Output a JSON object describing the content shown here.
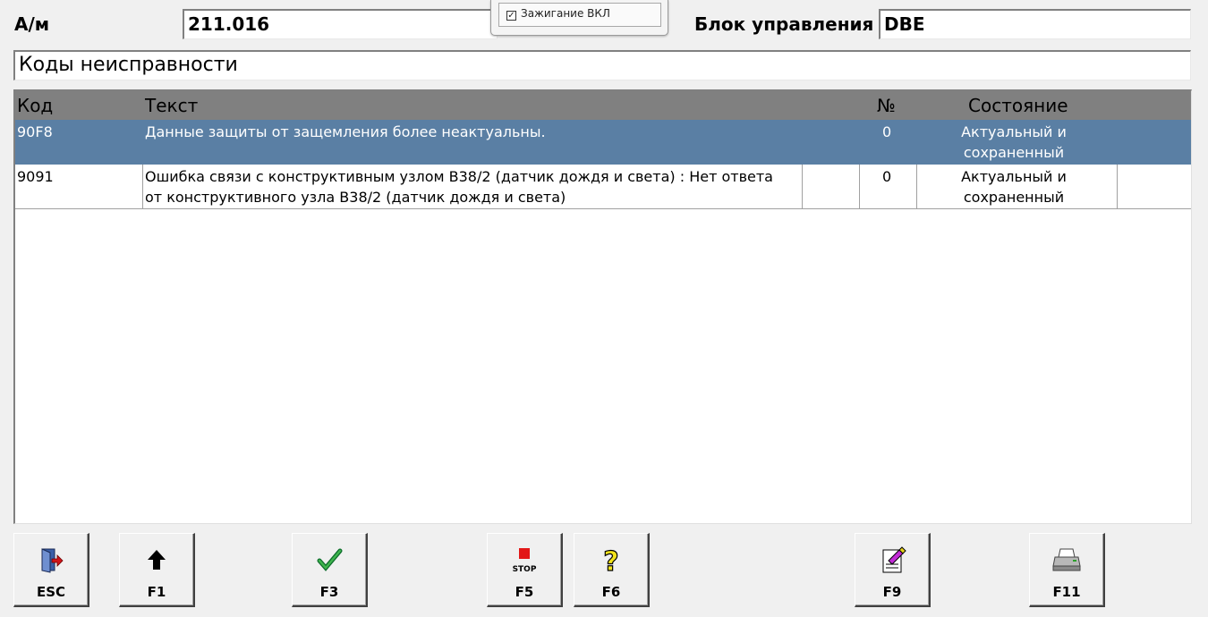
{
  "header": {
    "car_label": "А/м",
    "car_value": "211.016",
    "ecu_label": "Блок управления",
    "ecu_value": "DBE"
  },
  "ignition": {
    "label": "Зажигание ВКЛ",
    "checked": true
  },
  "section_title": "Коды неисправности",
  "table": {
    "columns": [
      "Код",
      "Текст",
      "№",
      "Состояние"
    ],
    "rows": [
      {
        "code": "90F8",
        "text": "Данные защиты от защемления более неактуальны.",
        "text2": "",
        "num": "0",
        "state1": "Актуальный и",
        "state2": "сохраненный",
        "selected": true
      },
      {
        "code": "9091",
        "text": "Ошибка связи с конструктивным узлом B38/2 (датчик дождя и света) : Нет ответа",
        "text2": "от конструктивного узла B38/2 (датчик дождя и света)",
        "num": "0",
        "state1": "Актуальный и",
        "state2": "сохраненный",
        "selected": false
      }
    ]
  },
  "buttons": [
    {
      "key": "ESC",
      "icon": "exit-door-icon"
    },
    {
      "key": "F1",
      "icon": "arrow-up-icon"
    },
    {
      "key": "F3",
      "icon": "checkmark-icon"
    },
    {
      "key": "F5",
      "icon": "stop-icon",
      "icon_text": "STOP"
    },
    {
      "key": "F6",
      "icon": "help-question-icon",
      "icon_text": "?"
    },
    {
      "key": "F9",
      "icon": "notepad-eraser-icon"
    },
    {
      "key": "F11",
      "icon": "printer-icon"
    }
  ],
  "colors": {
    "selected_row": "#5a7fa4",
    "header_bg": "#808080",
    "window_bg": "#f0f0f0"
  }
}
